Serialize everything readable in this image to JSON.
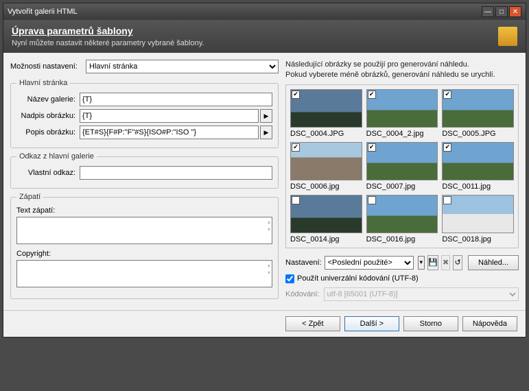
{
  "window": {
    "title": "Vytvořit galerii HTML"
  },
  "header": {
    "title": "Úprava parametrů šablony",
    "subtitle": "Nyní můžete nastavit některé parametry vybrané šablony."
  },
  "left": {
    "options_label": "Možnosti nastavení:",
    "options_value": "Hlavní stránka",
    "main_page": {
      "legend": "Hlavní stránka",
      "gallery_name_label": "Název galerie:",
      "gallery_name_value": "{T}",
      "image_caption_label": "Nadpis obrázku:",
      "image_caption_value": "{T}",
      "image_desc_label": "Popis obrázku:",
      "image_desc_value": "{ET#S}{F#P:\"F\"#S}{ISO#P:\"ISO \"}"
    },
    "link": {
      "legend": "Odkaz z hlavní galerie",
      "own_link_label": "Vlastní odkaz:",
      "own_link_value": ""
    },
    "footer_section": {
      "legend": "Zápatí",
      "footer_text_label": "Text zápatí:",
      "copyright_label": "Copyright:"
    }
  },
  "right": {
    "hint1": "Následující obrázky se použijí pro generování náhledu.",
    "hint2": "Pokud vyberete méně obrázků, generování náhledu se urychlí.",
    "thumbs": [
      {
        "name": "DSC_0004.JPG",
        "checked": true,
        "style": "dark"
      },
      {
        "name": "DSC_0004_2.jpg",
        "checked": true,
        "style": "sky"
      },
      {
        "name": "DSC_0005.JPG",
        "checked": true,
        "style": "sky"
      },
      {
        "name": "DSC_0006.jpg",
        "checked": true,
        "style": "building"
      },
      {
        "name": "DSC_0007.jpg",
        "checked": true,
        "style": "sky"
      },
      {
        "name": "DSC_0011.jpg",
        "checked": true,
        "style": "sky"
      },
      {
        "name": "DSC_0014.jpg",
        "checked": false,
        "style": "dark"
      },
      {
        "name": "DSC_0016.jpg",
        "checked": false,
        "style": "sky"
      },
      {
        "name": "DSC_0018.jpg",
        "checked": false,
        "style": "snow"
      }
    ],
    "settings_label": "Nastavení:",
    "settings_value": "<Poslední použité>",
    "preview_btn": "Náhled...",
    "utf8_label": "Použít univerzální kódování (UTF-8)",
    "encoding_label": "Kódování:",
    "encoding_value": "utf-8   [65001 (UTF-8)]"
  },
  "footer": {
    "back": "< Zpět",
    "next": "Další >",
    "cancel": "Storno",
    "help": "Nápověda"
  }
}
